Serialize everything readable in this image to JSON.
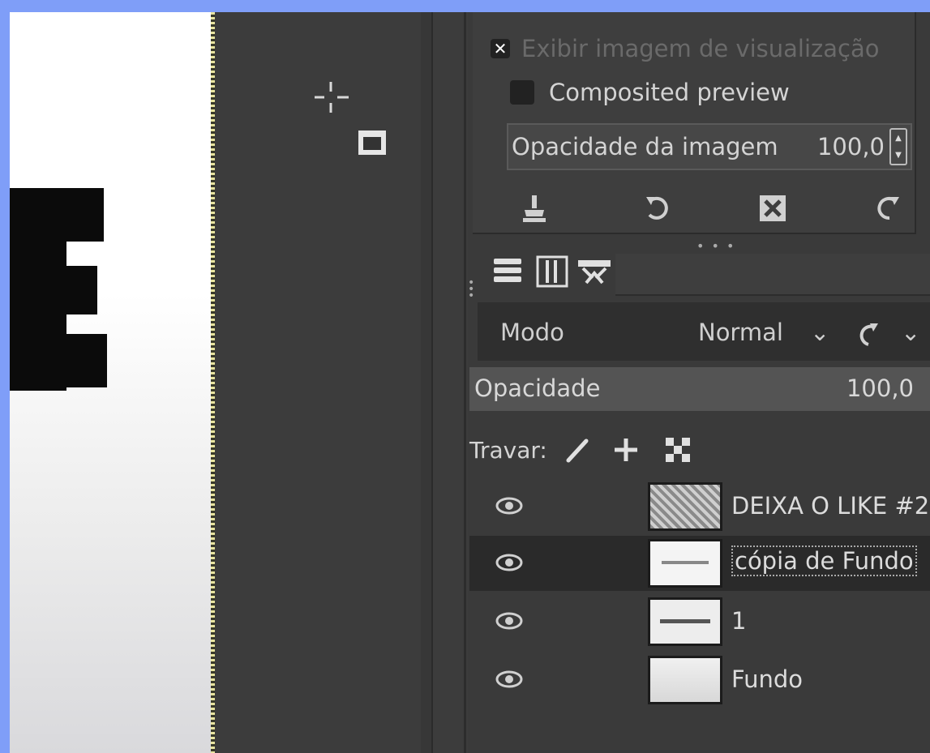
{
  "preview_options": {
    "show_preview_label": "Exibir imagem de visualização",
    "show_preview_checked": true,
    "composited_preview_label": "Composited preview",
    "composited_preview_checked": false,
    "image_opacity_label": "Opacidade da imagem",
    "image_opacity_value": "100,0"
  },
  "preview_actions": [
    {
      "name": "anchor-icon"
    },
    {
      "name": "undo-icon"
    },
    {
      "name": "clear-icon"
    },
    {
      "name": "redo-icon"
    }
  ],
  "dock_tabs": [
    {
      "name": "layers-tab-icon"
    },
    {
      "name": "channels-tab-icon"
    },
    {
      "name": "paths-tab-icon"
    }
  ],
  "layer_mode": {
    "label": "Modo",
    "value": "Normal"
  },
  "opacity": {
    "label": "Opacidade",
    "value": "100,0"
  },
  "lock": {
    "label": "Travar:"
  },
  "layers": [
    {
      "name": "DEIXA O LIKE #2",
      "visible": true,
      "selected": false,
      "editing": false
    },
    {
      "name": "cópia de Fundo",
      "visible": true,
      "selected": true,
      "editing": true
    },
    {
      "name": "1",
      "visible": true,
      "selected": false,
      "editing": false
    },
    {
      "name": "Fundo",
      "visible": true,
      "selected": false,
      "editing": false
    }
  ]
}
